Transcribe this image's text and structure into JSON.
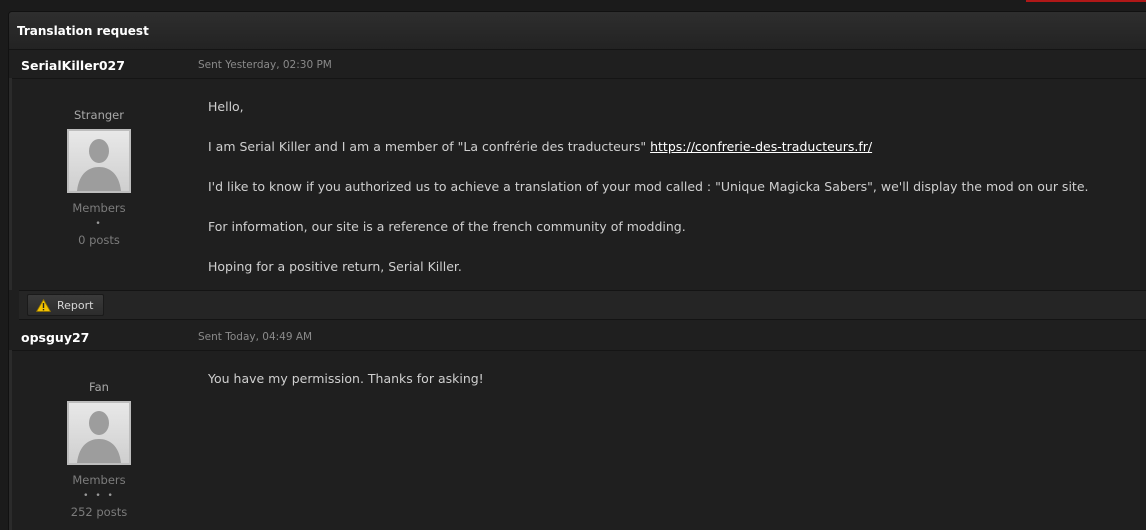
{
  "thread": {
    "title": "Translation request"
  },
  "messages": [
    {
      "author": "SerialKiller027",
      "sent": "Sent Yesterday, 02:30 PM",
      "rank": "Stranger",
      "group": "Members",
      "pips": "•",
      "posts": "0 posts",
      "body": {
        "greeting": "Hello,",
        "line1_prefix": "I am Serial Killer and I am a member of \"La confrérie des traducteurs\"",
        "line1_link": "https://confrerie-des-traducteurs.fr/",
        "line2": "I'd like to know if you authorized us to achieve a translation of your mod called : \"Unique Magicka Sabers\", we'll display the mod on our site.",
        "line3": "For information, our site is a reference of the french community of modding.",
        "line4": "Hoping for a positive return, Serial Killer."
      },
      "report_label": "Report"
    },
    {
      "author": "opsguy27",
      "sent": "Sent Today, 04:49 AM",
      "rank": "Fan",
      "group": "Members",
      "pips": "• • •",
      "posts": "252 posts",
      "body": {
        "line1": "You have my permission.  Thanks for asking!"
      }
    }
  ],
  "icons": {
    "avatar": "default-avatar-icon",
    "report": "warning-icon"
  },
  "colors": {
    "background": "#1f1f1f",
    "header_text": "#ffffff",
    "body_text": "#cfcfcf",
    "warning": "#f2c200"
  }
}
